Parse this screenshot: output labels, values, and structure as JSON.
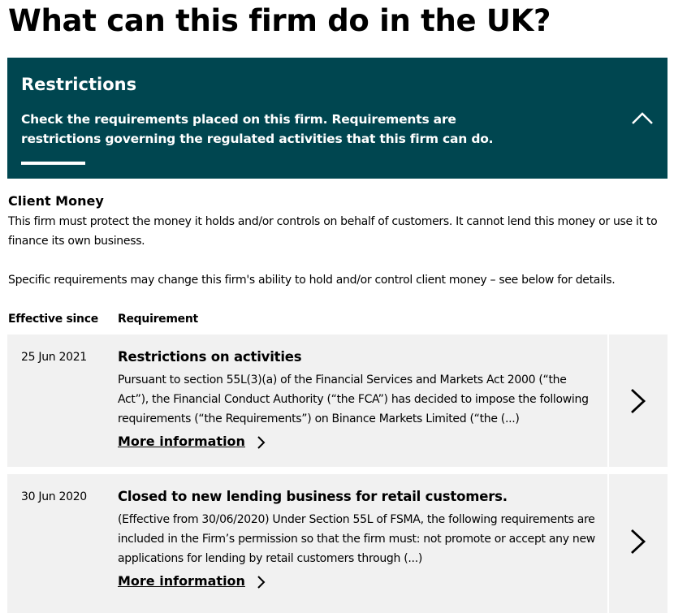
{
  "page": {
    "title": "What can this firm do in the UK?"
  },
  "panel": {
    "title": "Restrictions",
    "description": "Check the requirements placed on this firm. Requirements are restrictions governing the regulated activities that this firm can do.",
    "toggle_icon": "chevron-up-icon",
    "background_color": "#004650"
  },
  "client_money": {
    "title": "Client Money",
    "text": "This firm must protect the money it holds and/or controls on behalf of customers. It cannot lend this money or use it to finance its own business.",
    "note": "Specific requirements may change this firm's ability to hold and/or control client money – see below for details."
  },
  "table": {
    "headers": [
      "Effective since",
      "Requirement"
    ],
    "rows": [
      {
        "date": "25 Jun 2021",
        "title": "Restrictions on activities",
        "body": "Pursuant to section 55L(3)(a) of the Financial Services and Markets Act 2000 (“the Act”), the Financial Conduct Authority (“the FCA”) has decided to impose the following requirements (“the Requirements”) on Binance Markets Limited (“the (...)",
        "link": "More information"
      },
      {
        "date": "30 Jun 2020",
        "title": "Closed to new lending business for retail customers.",
        "body": "(Effective from 30/06/2020) Under Section 55L of FSMA, the following requirements are included in the Firm’s permission so that the firm must: not promote or accept any new applications for lending by retail customers through (...)",
        "link": "More information"
      }
    ]
  }
}
